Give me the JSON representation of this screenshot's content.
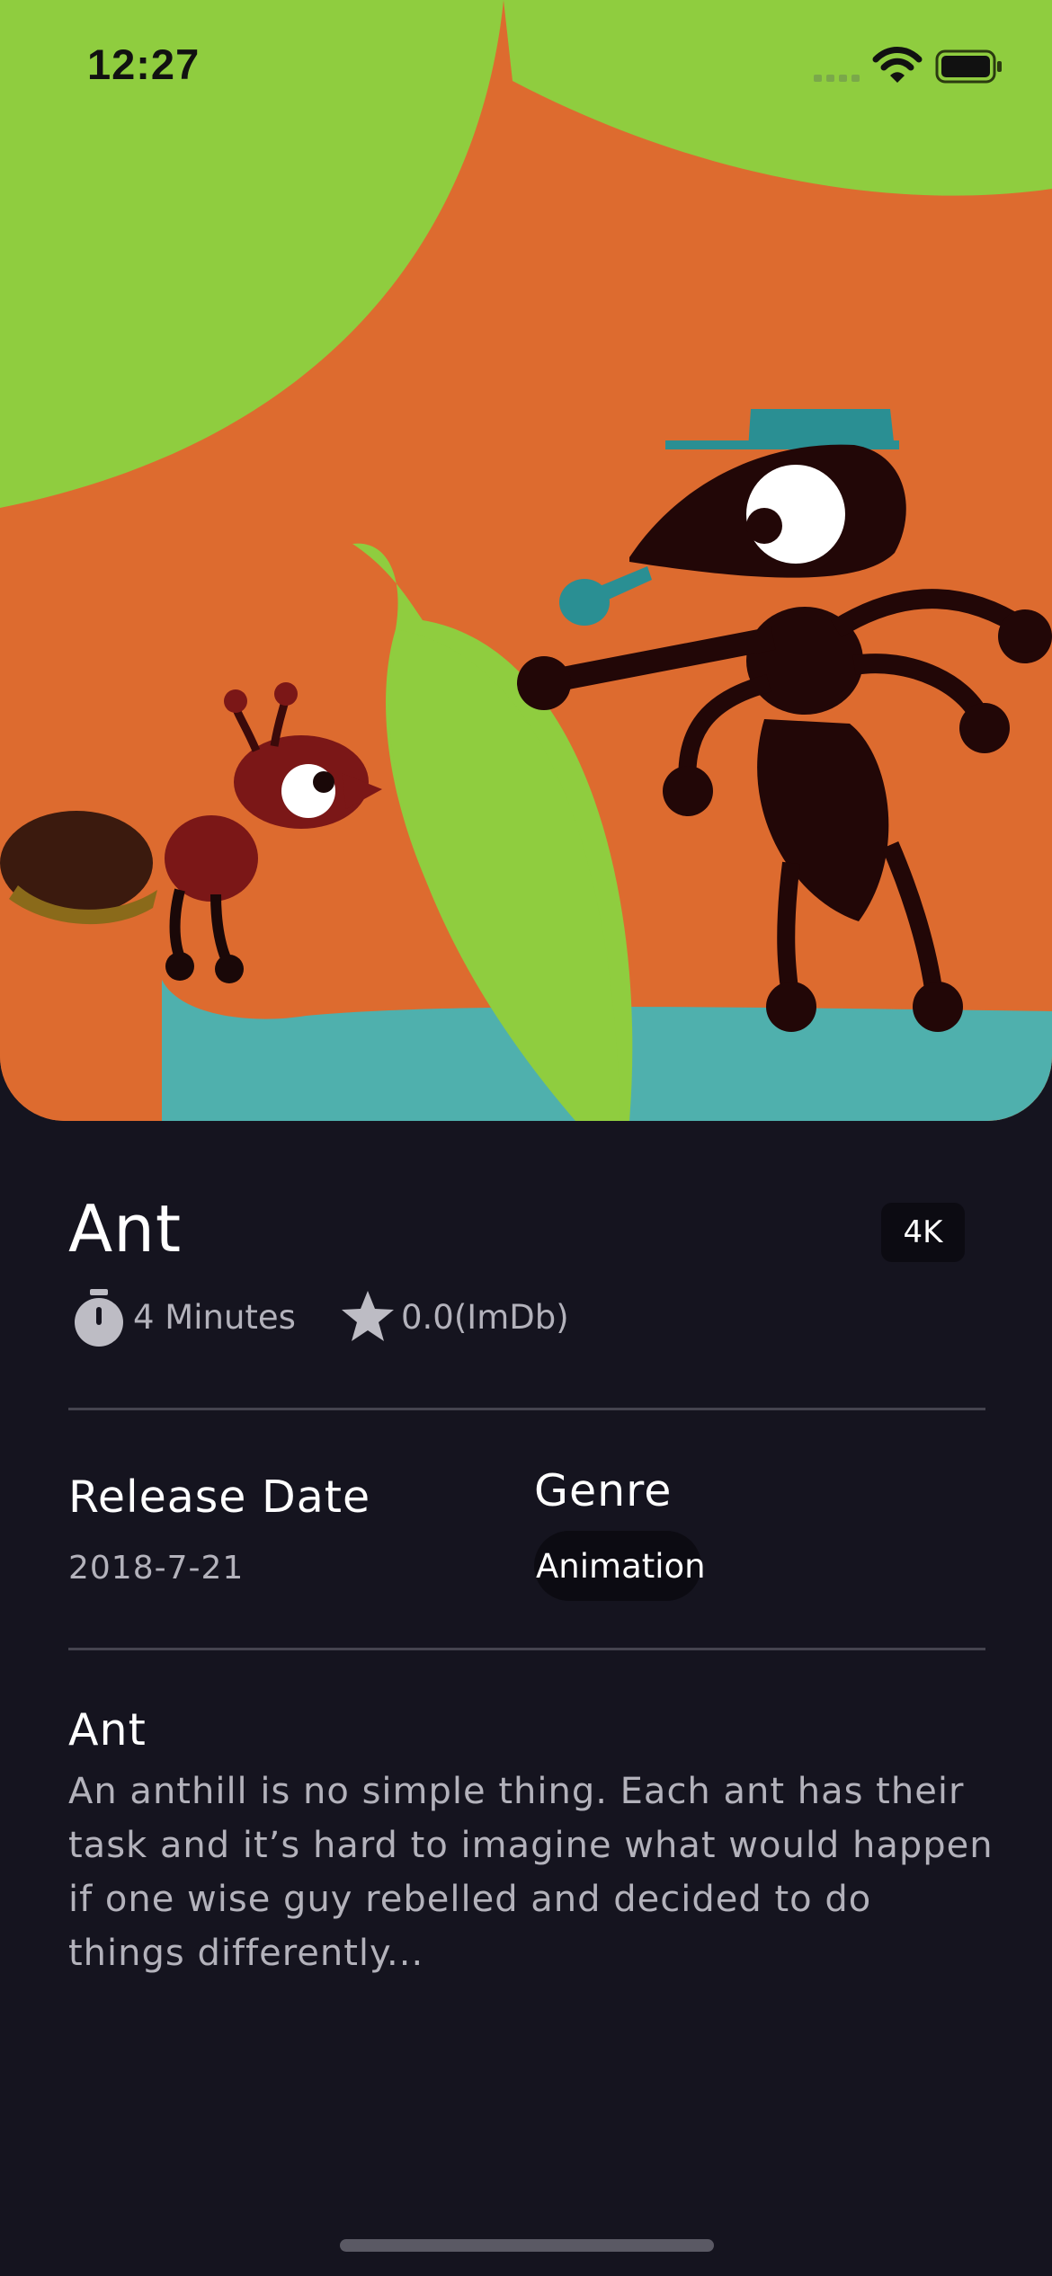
{
  "status_bar": {
    "time": "12:27"
  },
  "movie": {
    "title": "Ant",
    "quality": "4K",
    "duration": "4 Minutes",
    "rating": "0.0(ImDb)",
    "release_label": "Release Date",
    "release_date": "2018-7-21",
    "genre_label": "Genre",
    "genre": "Animation",
    "description_title": "Ant",
    "description": "An anthill is no simple thing. Each ant has their task and it’s hard to imagine what would happen if one wise guy rebelled and decided to do things differently..."
  },
  "icons": {
    "timer": "stopwatch-icon",
    "star": "star-icon",
    "signal": "cellular-signal-icon",
    "wifi": "wifi-icon",
    "battery": "battery-icon"
  },
  "colors": {
    "background": "#15141f",
    "poster_orange": "#dd6b2f",
    "poster_green": "#8fcd3f",
    "text_primary": "#ffffff",
    "text_secondary": "#b3b2bb"
  }
}
